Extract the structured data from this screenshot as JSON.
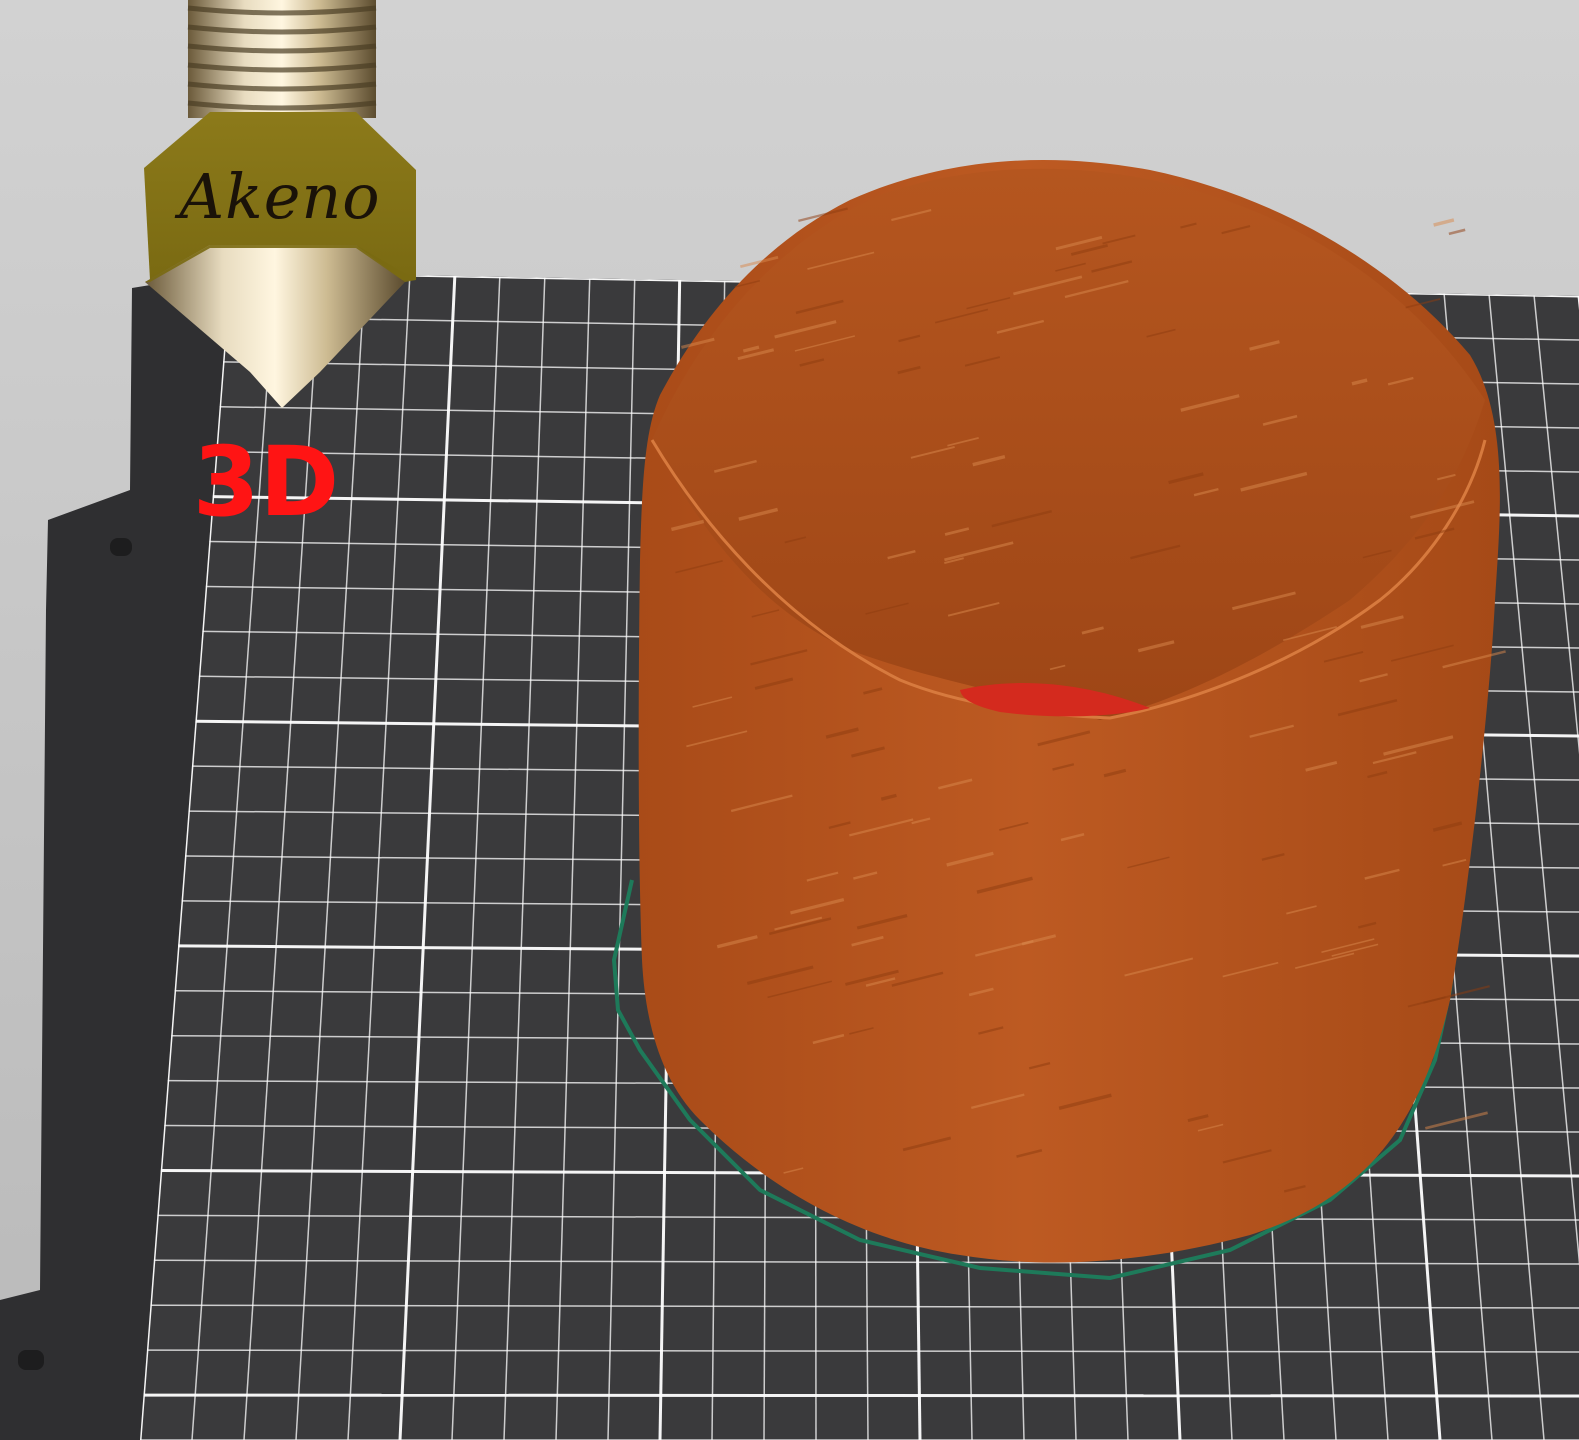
{
  "viewport": {
    "label": "3d-preview-viewport"
  },
  "logo": {
    "brand": "Akeno",
    "suffix": "3D",
    "icon": "nozzle-icon",
    "brand_color": "#ff1414"
  },
  "print_object": {
    "icon": "cylindrical-print-model",
    "color": "#b8561f"
  },
  "bed": {
    "color": "#3a3a3c",
    "grid_color": "#ffffff"
  },
  "skirt": {
    "color": "#1e7a5a"
  }
}
